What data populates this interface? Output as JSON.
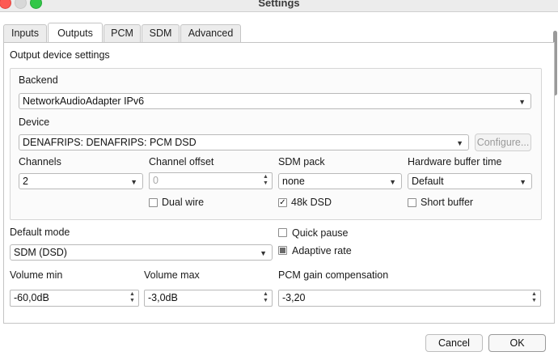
{
  "window": {
    "title": "Settings"
  },
  "tabs": [
    {
      "label": "Inputs"
    },
    {
      "label": "Outputs"
    },
    {
      "label": "PCM"
    },
    {
      "label": "SDM"
    },
    {
      "label": "Advanced"
    }
  ],
  "output": {
    "heading": "Output device settings",
    "backend": {
      "label": "Backend",
      "value": "NetworkAudioAdapter IPv6"
    },
    "device": {
      "label": "Device",
      "value": "DENAFRIPS: DENAFRIPS: PCM DSD",
      "configure_label": "Configure..."
    },
    "channels": {
      "label": "Channels",
      "value": "2"
    },
    "channel_offset": {
      "label": "Channel offset",
      "value": "0"
    },
    "sdm_pack": {
      "label": "SDM pack",
      "value": "none"
    },
    "hw_buffer": {
      "label": "Hardware buffer time",
      "value": "Default"
    },
    "dual_wire": {
      "label": "Dual wire",
      "checked": false
    },
    "dsd48k": {
      "label": "48k DSD",
      "checked": true
    },
    "short_buffer": {
      "label": "Short buffer",
      "checked": false
    }
  },
  "default_mode": {
    "label": "Default mode",
    "value": "SDM (DSD)"
  },
  "quick_pause": {
    "label": "Quick pause",
    "checked": false
  },
  "adaptive_rate": {
    "label": "Adaptive rate",
    "state": "partial"
  },
  "volume_min": {
    "label": "Volume min",
    "value": "-60,0dB"
  },
  "volume_max": {
    "label": "Volume max",
    "value": "-3,0dB"
  },
  "pcm_gain": {
    "label": "PCM gain compensation",
    "value": "-3,20"
  },
  "footer": {
    "cancel_label": "Cancel",
    "ok_label": "OK"
  }
}
